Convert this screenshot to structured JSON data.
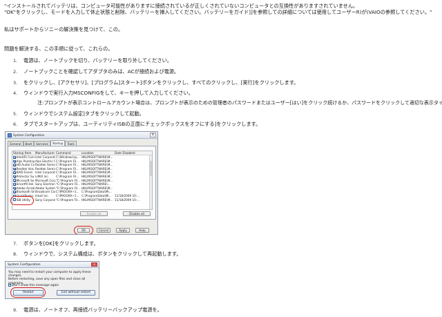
{
  "doc": {
    "line1": "\"インストールされてバッテリは、コンピュータ可能性がありますに接続されているが正しくされていないコンピュータとの互換性がありますされていません。",
    "line2": "\"OK\"をクリックし、モードを入力して休止状態と削除、バッテリーを挿入してください。バッテリーをガイド]]を参照しての詳細については使用してユーザーR)が(VAIOの参照してください。\"",
    "support": "私はサポートからソニーの解決策を見つけて、この。",
    "intro": "問題を解決する、この手順に従って、これらの。",
    "steps": [
      {
        "n": "1.",
        "text": "電源は、ノートブックを切り、バッテリーを取り外してください。"
      },
      {
        "n": "2.",
        "text": "ノートブックことを確認してアダプタのみは、ACが接続および電源。"
      },
      {
        "n": "3.",
        "text": "をクリックし、[アクセサリ]、[プログラム]スタート]ボタンをクリックし、すべてのクリックし、[実行]をクリックします。"
      },
      {
        "n": "4.",
        "text": "ウィンドウで実行入力MSCONFIGをして、キーを押して入力してください。"
      },
      {
        "n": "",
        "text": "注:プロンプトが表示コントロールアカウント場合は、プロンプトが表示のための管理者のパスワードまたはユーザー[はい]をクリック続けるか、パスワードをクリックして適切な表示タイプを。"
      },
      {
        "n": "5.",
        "text": "ウィンドウでシステム設定]タブをクリックして起動。"
      },
      {
        "n": "6.",
        "text": "タブでスタートアップは、ユーティリティISBの正面にチェックボックスをオフにする]をクリックします。"
      },
      {
        "n": "7.",
        "text": "ボタンを[OK]をクリックします。"
      },
      {
        "n": "8.",
        "text": "ウィンドウで、システム構成は、ボタンをクリックして再起動します。"
      },
      {
        "n": "9.",
        "text": "電源は、ノートオフ、再接続バッテリーバックアップ電源を。"
      }
    ]
  },
  "sysconfig": {
    "title": "System Configuration",
    "close_glyph": "x",
    "tabs": [
      "General",
      "Boot",
      "Services",
      "Startup",
      "Tools"
    ],
    "active_tab": "Startup",
    "columns": [
      "Startup Item",
      "Manufacturer",
      "Command",
      "Location",
      "Date Disabled"
    ],
    "rows": [
      {
        "item": "Intel(R) Com...",
        "mfr": "Intel Corporation",
        "cmd": "C:\\Windows\\sy...",
        "loc": "HKLM\\SOFTWARE\\M...",
        "date": "",
        "checked": true
      },
      {
        "item": "Alps Pointing...",
        "mfr": "Alps Electric Co...",
        "cmd": "C:\\Program Fil...",
        "loc": "HKLM\\SOFTWARE\\M...",
        "date": "",
        "checked": true
      },
      {
        "item": "HD Audio Co...",
        "mfr": "Realtek Semico...",
        "cmd": "C:\\Program Fil...",
        "loc": "HKLM\\SOFTWARE\\M...",
        "date": "",
        "checked": true
      },
      {
        "item": "Realtek Voic...",
        "mfr": "Realtek Semico...",
        "cmd": "C:\\Program Fil...",
        "loc": "HKLM\\SOFTWARE\\M...",
        "date": "",
        "checked": true
      },
      {
        "item": "RAID Event ...",
        "mfr": "Intel Corporation",
        "cmd": "C:\\Program Fil...",
        "loc": "HKLM\\SOFTWARE\\M...",
        "date": "",
        "checked": true
      },
      {
        "item": "Protector Su...",
        "mfr": "LiMiX Inc.",
        "cmd": "C:\\Program Fil...",
        "loc": "HKLM\\SOFTWARE\\M...",
        "date": "",
        "checked": true
      },
      {
        "item": "Microsoft Se...",
        "mfr": "Microsoft Corp...",
        "cmd": "\"C:\\Program Fil...",
        "loc": "HKLM\\SOFTWARE\\M...",
        "date": "",
        "checked": true
      },
      {
        "item": "Smartfil Hel...",
        "mfr": "Sony Electronic...",
        "cmd": "\"C:\\Program Fil...",
        "loc": "HKLM\\SOFTWARE\\...",
        "date": "",
        "checked": true
      },
      {
        "item": "Adobe Acrobat",
        "mfr": "Adobe System...",
        "cmd": "\"C:\\Program Fil...",
        "loc": "HKLM\\SOFTWARE\\M...",
        "date": "",
        "checked": true
      },
      {
        "item": "Bluetooth Sm...",
        "mfr": "Broadcom Corp...",
        "cmd": "C:\\PROGRA~1...",
        "loc": "C:\\ProgramData\\Mi...",
        "date": "",
        "checked": true
      },
      {
        "item": "QuickBooks...",
        "mfr": "Intuit Inc.",
        "cmd": "C:\\PROGRA~1...",
        "loc": "C:\\ProgramData\\Mi...",
        "date": "11/18/2009 10:...",
        "checked": false
      },
      {
        "item": "ISB Utility",
        "mfr": "Sony Corporation",
        "cmd": "\"C:\\Program Fil...",
        "loc": "HKLM\\SOFTWARE\\M...",
        "date": "11/18/2009 10:...",
        "checked": false
      }
    ],
    "enable_all": "Enable all",
    "disable_all": "Disable all",
    "ok": "OK",
    "cancel": "Cancel",
    "apply": "Apply",
    "help": "Help"
  },
  "restart": {
    "title": "System Configuration",
    "close_glyph": "x",
    "msg1": "You may need to restart your computer to apply these changes.",
    "msg2": "Before restarting, save any open files and close all programs.",
    "dont_show": "Don't show this message again",
    "restart_btn": "Restart",
    "exit_btn": "Exit without restart"
  }
}
